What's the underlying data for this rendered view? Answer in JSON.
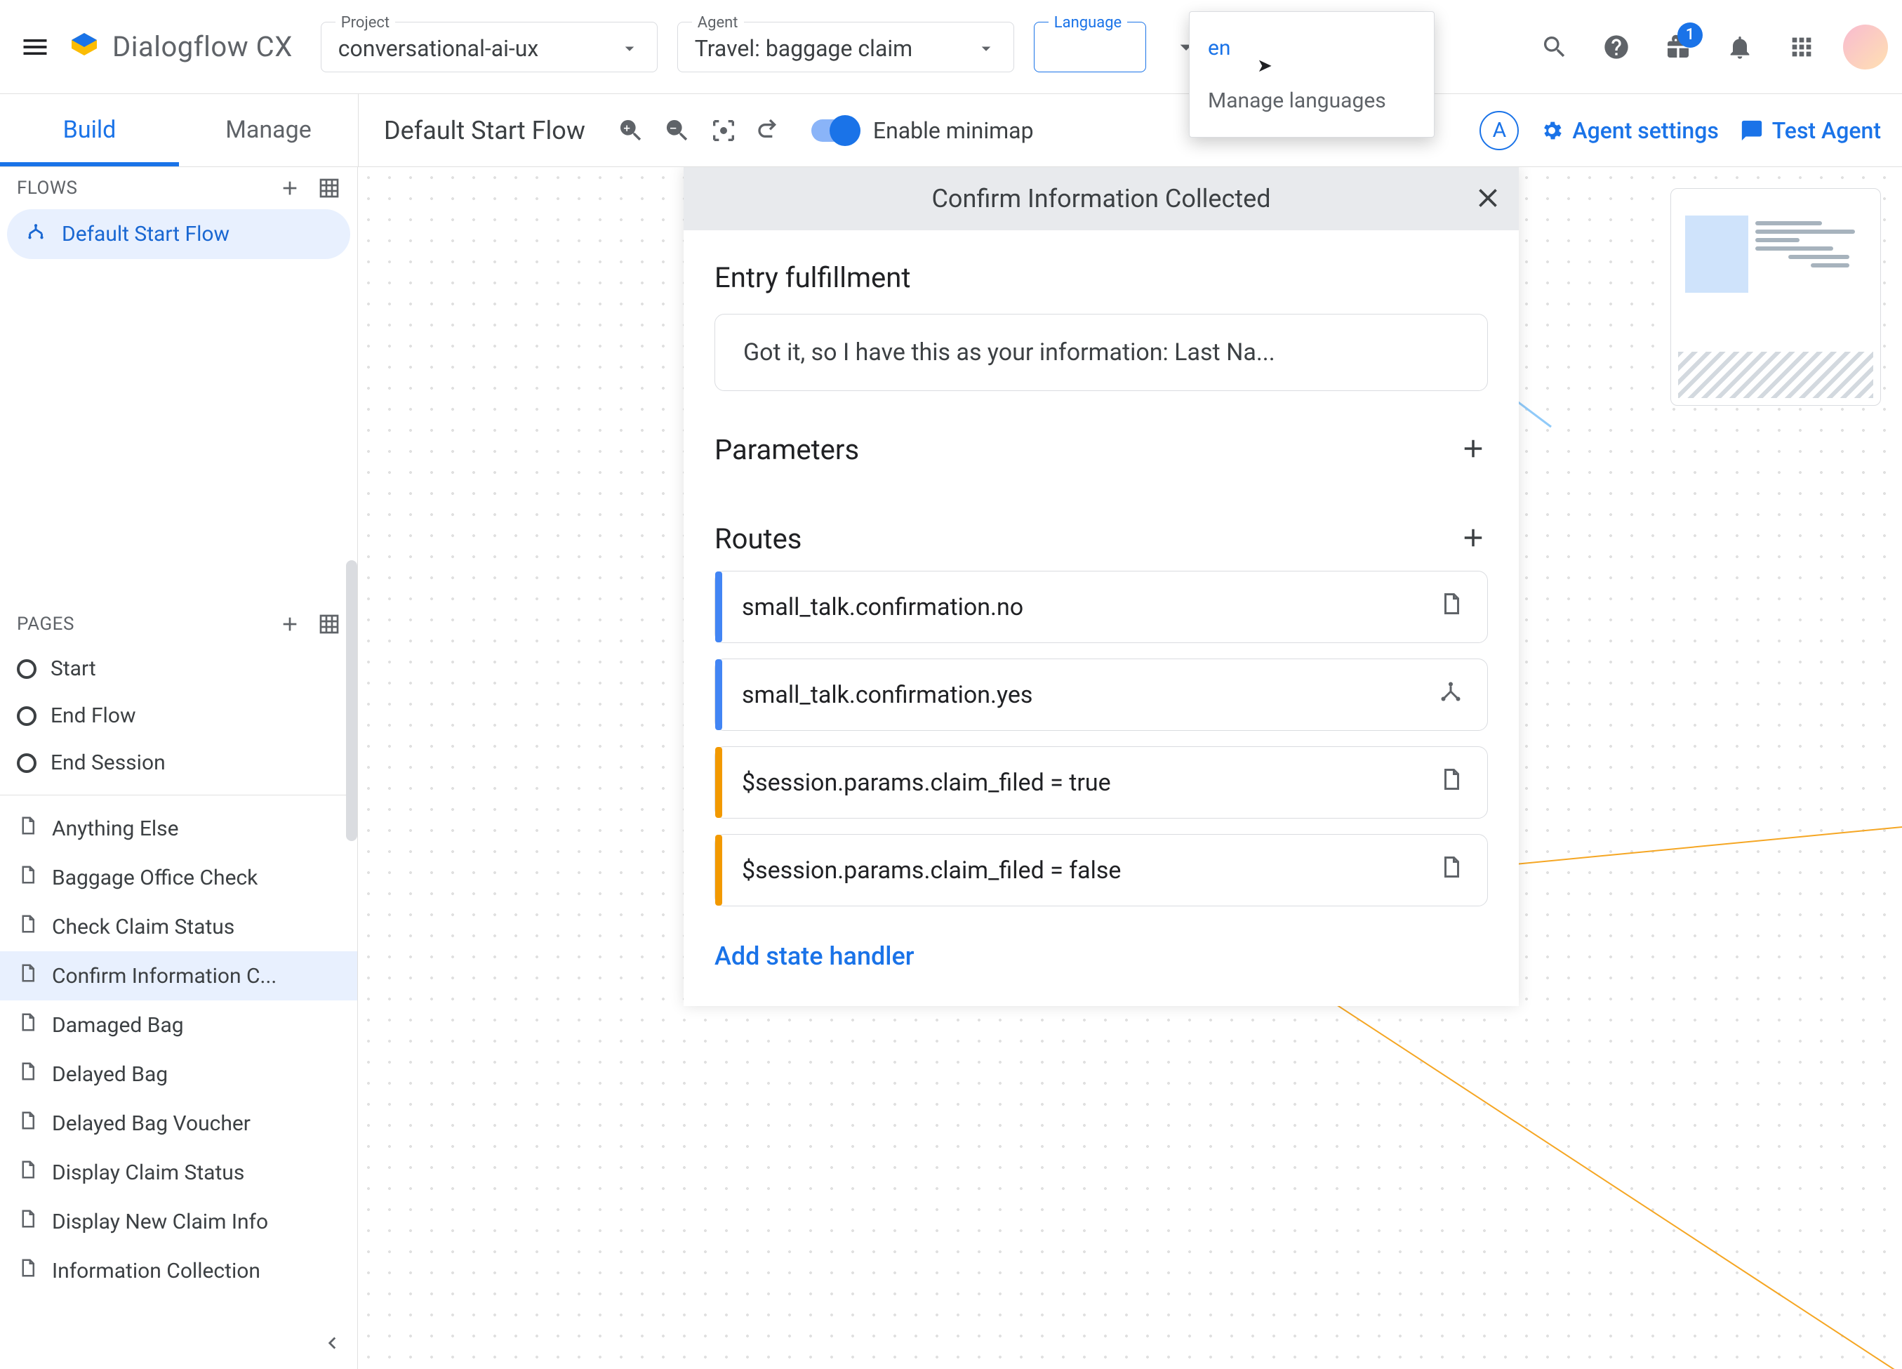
{
  "brand": {
    "name": "Dialogflow CX"
  },
  "selectors": {
    "project": {
      "label": "Project",
      "value": "conversational-ai-ux"
    },
    "agent": {
      "label": "Agent",
      "value": "Travel: baggage claim"
    },
    "language": {
      "label": "Language",
      "value": ""
    }
  },
  "language_dropdown": {
    "item": "en",
    "manage": "Manage languages"
  },
  "top_actions": {
    "badge": "1"
  },
  "tabs": {
    "build": "Build",
    "manage": "Manage"
  },
  "flow_bar": {
    "title": "Default Start Flow",
    "toggle_label": "Enable minimap",
    "agent_settings": "Agent settings",
    "test_agent": "Test Agent",
    "avatar_letter": "A"
  },
  "sidebar": {
    "flows_label": "FLOWS",
    "flows": [
      {
        "name": "Default Start Flow"
      }
    ],
    "pages_label": "PAGES",
    "special_pages": [
      {
        "name": "Start"
      },
      {
        "name": "End Flow"
      },
      {
        "name": "End Session"
      }
    ],
    "pages": [
      {
        "name": "Anything Else"
      },
      {
        "name": "Baggage Office Check"
      },
      {
        "name": "Check Claim Status"
      },
      {
        "name": "Confirm Information C...",
        "selected": true
      },
      {
        "name": "Damaged Bag"
      },
      {
        "name": "Delayed Bag"
      },
      {
        "name": "Delayed Bag Voucher"
      },
      {
        "name": "Display Claim Status"
      },
      {
        "name": "Display New Claim Info"
      },
      {
        "name": "Information Collection"
      }
    ]
  },
  "panel": {
    "title": "Confirm Information Collected",
    "entry_header": "Entry fulfillment",
    "entry_text": "Got it, so I have this as your information: Last Na...",
    "parameters_header": "Parameters",
    "routes_header": "Routes",
    "routes": [
      {
        "label": "small_talk.confirmation.no",
        "color": "blue",
        "icon": "page"
      },
      {
        "label": "small_talk.confirmation.yes",
        "color": "blue",
        "icon": "flow"
      },
      {
        "label": "$session.params.claim_filed = true",
        "color": "orange",
        "icon": "page"
      },
      {
        "label": "$session.params.claim_filed = false",
        "color": "orange",
        "icon": "page"
      }
    ],
    "add_handler": "Add state handler"
  }
}
